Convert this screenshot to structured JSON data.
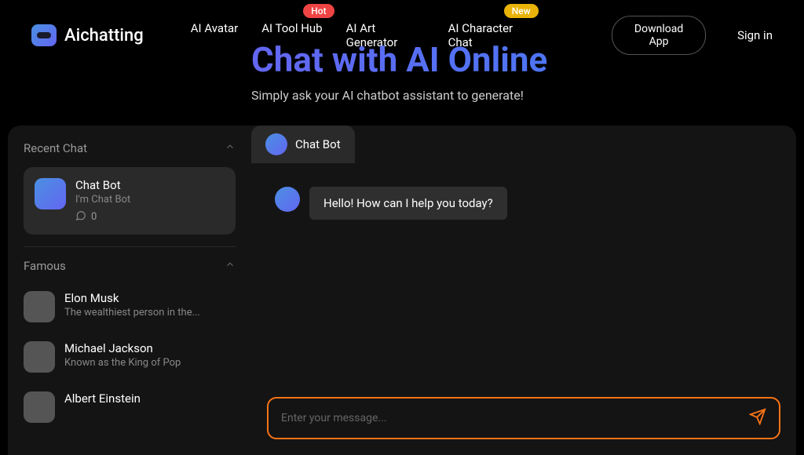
{
  "brand": {
    "name": "Aichatting"
  },
  "nav": {
    "items": [
      {
        "label": "AI Avatar",
        "badge": null
      },
      {
        "label": "AI Tool Hub",
        "badge": "Hot",
        "badge_type": "hot"
      },
      {
        "label": "AI Art Generator",
        "badge": null
      },
      {
        "label": "AI Character Chat",
        "badge": "New",
        "badge_type": "new"
      }
    ],
    "download": "Download App",
    "signin": "Sign in"
  },
  "hero": {
    "title": "Chat with AI Online",
    "subtitle": "Simply ask your AI chatbot assistant to generate!"
  },
  "sidebar": {
    "recent": {
      "title": "Recent Chat",
      "items": [
        {
          "name": "Chat Bot",
          "desc": "I'm Chat Bot",
          "count": "0"
        }
      ]
    },
    "famous": {
      "title": "Famous",
      "items": [
        {
          "name": "Elon Musk",
          "desc": "The wealthiest person in the..."
        },
        {
          "name": "Michael Jackson",
          "desc": "Known as the King of Pop"
        },
        {
          "name": "Albert Einstein",
          "desc": ""
        }
      ]
    }
  },
  "chat": {
    "active_tab": "Chat Bot",
    "messages": [
      {
        "text": "Hello! How can I help you today?"
      }
    ],
    "input_placeholder": "Enter your message..."
  }
}
